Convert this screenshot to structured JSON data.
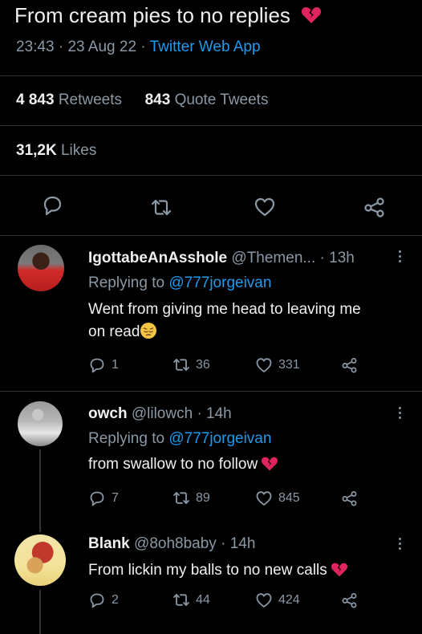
{
  "tweet": {
    "text": "From cream pies to no replies",
    "time": "23:43",
    "date": "23 Aug 22",
    "source": "Twitter Web App",
    "retweets_count": "4 843",
    "retweets_label": "Retweets",
    "quotes_count": "843",
    "quotes_label": "Quote Tweets",
    "likes_count": "31,2K",
    "likes_label": "Likes"
  },
  "replies": [
    {
      "name": "IgottabeAnAsshole",
      "handle": "@Themen...",
      "age": "13h",
      "replying_label": "Replying to",
      "replying_to": "@777jorgeivan",
      "text_line1": "Went from giving me head to leaving me",
      "text_line2": "on read",
      "emoji": "pensive-face",
      "reply_count": "1",
      "retweet_count": "36",
      "like_count": "331"
    },
    {
      "name": "owch",
      "handle": "@lilowch",
      "age": "14h",
      "replying_label": "Replying to",
      "replying_to": "@777jorgeivan",
      "text": "from swallow to no follow",
      "emoji": "broken-heart",
      "reply_count": "7",
      "retweet_count": "89",
      "like_count": "845"
    },
    {
      "name": "Blank",
      "handle": "@8oh8baby",
      "age": "14h",
      "text": "From lickin my balls to no new calls",
      "emoji": "broken-heart",
      "reply_count": "2",
      "retweet_count": "44",
      "like_count": "424"
    }
  ],
  "colors": {
    "background": "#000000",
    "text": "#eef0f1",
    "muted": "#8b98a5",
    "link": "#1d9bf0",
    "divider": "#2f3336",
    "broken_heart": "#e0245e"
  }
}
